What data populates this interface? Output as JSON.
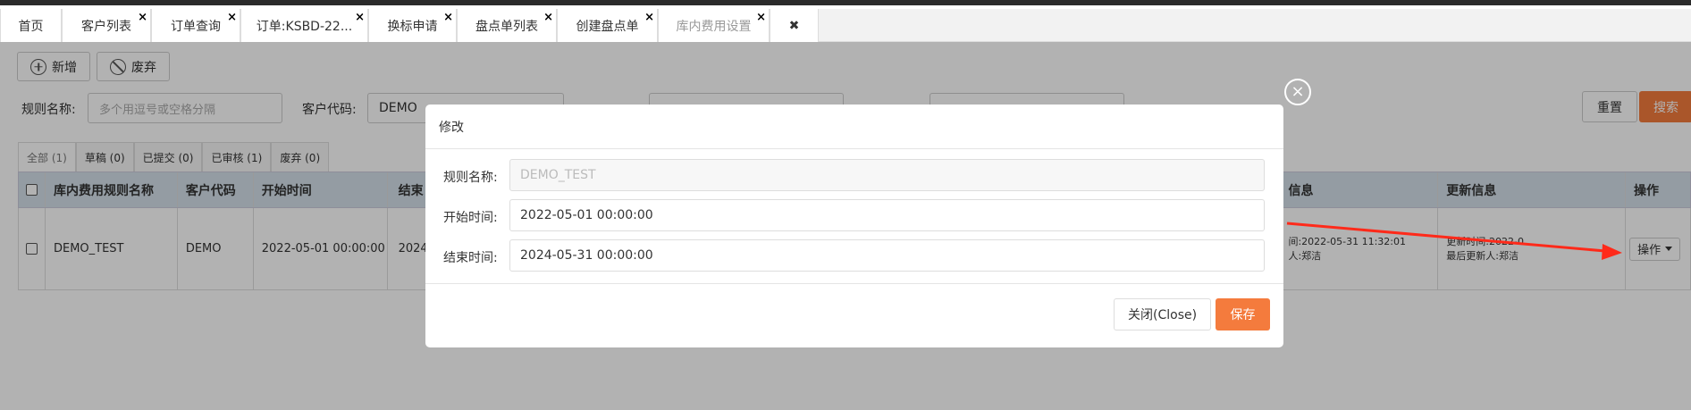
{
  "tabs": [
    {
      "label": "首页",
      "closable": false
    },
    {
      "label": "客户列表",
      "closable": true
    },
    {
      "label": "订单查询",
      "closable": true
    },
    {
      "label": "订单:KSBD-22...",
      "closable": true
    },
    {
      "label": "换标申请",
      "closable": true
    },
    {
      "label": "盘点单列表",
      "closable": true
    },
    {
      "label": "创建盘点单",
      "closable": true
    },
    {
      "label": "库内费用设置",
      "closable": true,
      "active": true
    }
  ],
  "tab_close_glyph": "×",
  "close_all_glyph": "✖",
  "toolbar": {
    "add_label": "新增",
    "discard_label": "废弃"
  },
  "filters": {
    "rule_name_label": "规则名称:",
    "rule_name_placeholder": "多个用逗号或空格分隔",
    "customer_code_label": "客户代码:",
    "customer_code_value": "DEMO",
    "reset_label": "重置",
    "search_label": "搜索"
  },
  "status_tabs": [
    {
      "label": "全部 (1)",
      "active": true
    },
    {
      "label": "草稿 (0)"
    },
    {
      "label": "已提交 (0)"
    },
    {
      "label": "已审核 (1)"
    },
    {
      "label": "废弃 (0)"
    }
  ],
  "table": {
    "headers": [
      "库内费用规则名称",
      "客户代码",
      "开始时间",
      "结束",
      "信息",
      "更新信息",
      "操作"
    ],
    "row": {
      "name": "DEMO_TEST",
      "customer": "DEMO",
      "start": "2022-05-01 00:00:00",
      "end_partial": "2024",
      "create_line1": "间:2022-05-31 11:32:01",
      "create_line2": "人:郑洁",
      "update_line1": "更新时间:2022-0",
      "update_line2": "最后更新人:郑洁",
      "op_label": "操作"
    }
  },
  "modal": {
    "title": "修改",
    "close_glyph": "×",
    "rule_name_label": "规则名称:",
    "rule_name_value": "DEMO_TEST",
    "start_label": "开始时间:",
    "start_value": "2022-05-01 00:00:00",
    "end_label": "结束时间:",
    "end_value": "2024-05-31 00:00:00",
    "close_label": "关闭(Close)",
    "save_label": "保存"
  },
  "colors": {
    "accent": "#f47b3d",
    "header_bg": "#d4e0ea",
    "annotation_arrow": "#ff2a1a"
  }
}
